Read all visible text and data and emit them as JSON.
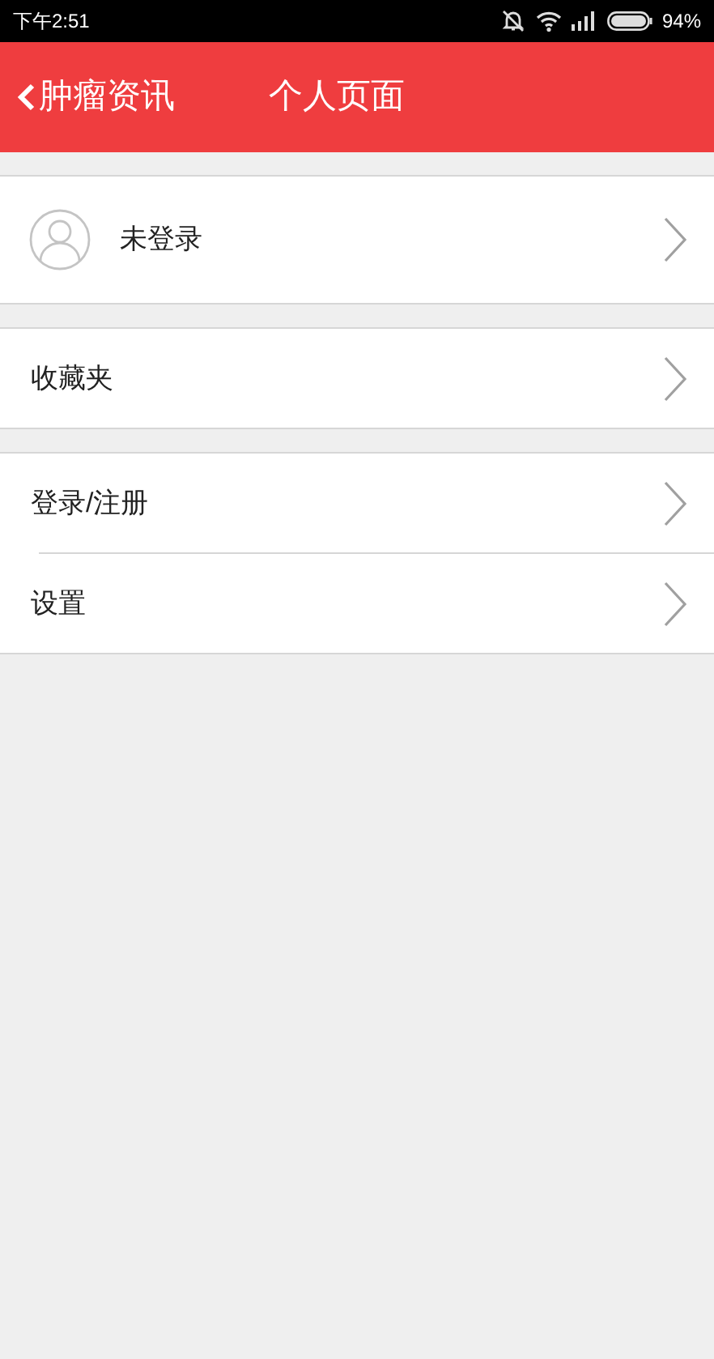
{
  "status_bar": {
    "time": "下午2:51",
    "battery": "94%"
  },
  "header": {
    "back_label": "肿瘤资讯",
    "title": "个人页面"
  },
  "profile": {
    "name": "未登录"
  },
  "sections": [
    {
      "items": [
        {
          "label": "收藏夹"
        }
      ]
    },
    {
      "items": [
        {
          "label": "登录/注册"
        },
        {
          "label": "设置"
        }
      ]
    }
  ]
}
